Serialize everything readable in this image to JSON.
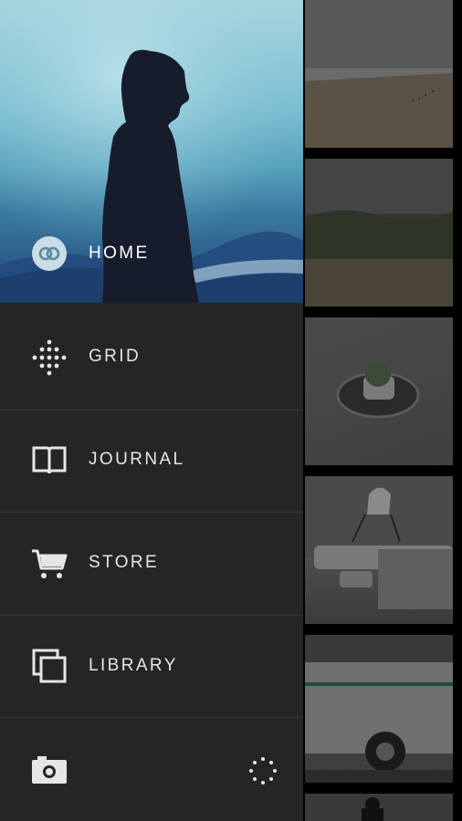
{
  "menu": {
    "items": [
      {
        "label": "HOME",
        "icon": "vsco-logo-icon"
      },
      {
        "label": "GRID",
        "icon": "grid-dots-icon"
      },
      {
        "label": "JOURNAL",
        "icon": "book-icon"
      },
      {
        "label": "STORE",
        "icon": "cart-icon"
      },
      {
        "label": "LIBRARY",
        "icon": "library-icon"
      }
    ]
  },
  "footer": {
    "camera_icon": "camera-icon",
    "shutter_icon": "shutter-dots-icon"
  },
  "colors": {
    "drawer_bg": "#252525",
    "divider": "#353535",
    "text": "#e6e6e6"
  }
}
